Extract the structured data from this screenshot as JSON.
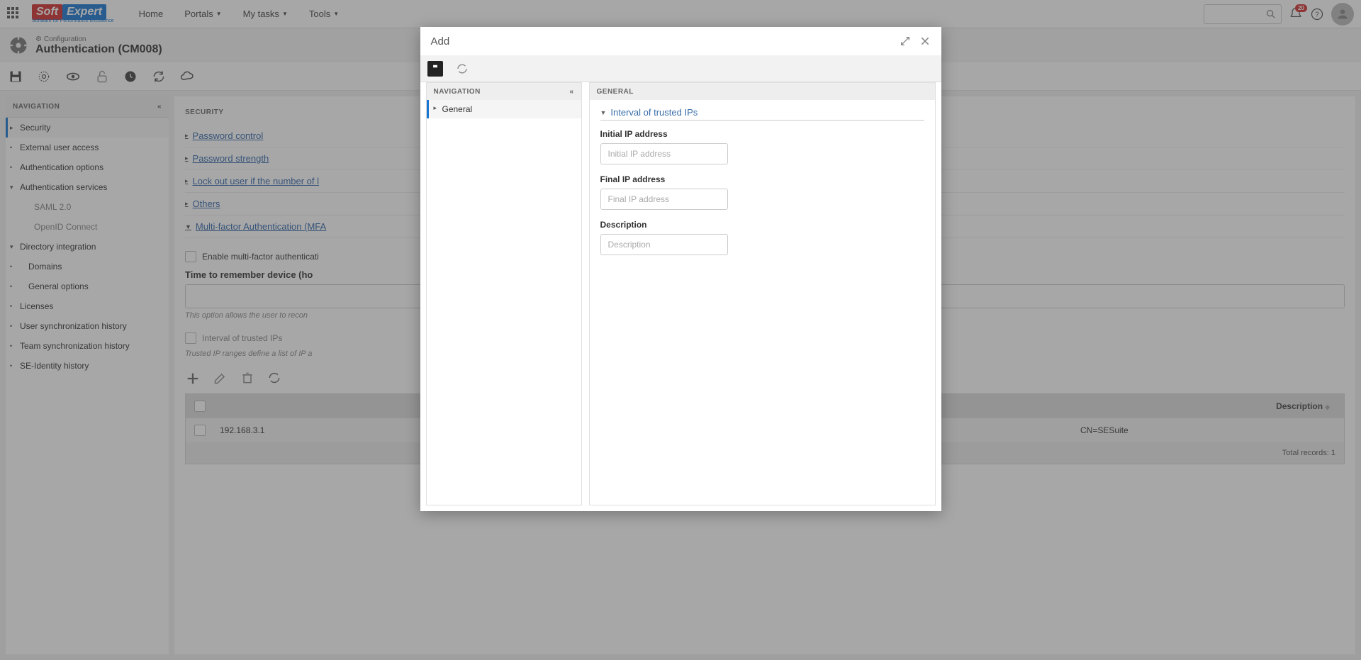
{
  "top": {
    "logo_soft": "Soft",
    "logo_expert": "Expert",
    "logo_sub": "Software for Performance Excellence",
    "home": "Home",
    "portals": "Portals",
    "mytasks": "My tasks",
    "tools": "Tools",
    "notif_count": "20"
  },
  "subheader": {
    "crumb": "Configuration",
    "title": "Authentication (CM008)"
  },
  "sidebar": {
    "title": "NAVIGATION",
    "items": [
      {
        "label": "Security",
        "type": "arrow-right",
        "active": true
      },
      {
        "label": "External user access",
        "type": "dot"
      },
      {
        "label": "Authentication options",
        "type": "dot"
      },
      {
        "label": "Authentication services",
        "type": "arrow-down"
      },
      {
        "label": "SAML 2.0",
        "type": "sub"
      },
      {
        "label": "OpenID Connect",
        "type": "sub"
      },
      {
        "label": "Directory integration",
        "type": "arrow-down"
      },
      {
        "label": "Domains",
        "type": "dot-sub"
      },
      {
        "label": "General options",
        "type": "dot-sub"
      },
      {
        "label": "Licenses",
        "type": "dot"
      },
      {
        "label": "User synchronization history",
        "type": "dot"
      },
      {
        "label": "Team synchronization history",
        "type": "dot"
      },
      {
        "label": "SE-Identity history",
        "type": "dot"
      }
    ]
  },
  "security": {
    "title": "SECURITY",
    "links": [
      "Password control",
      "Password strength",
      "Lock out user if the number of l",
      "Others"
    ],
    "mfa_title": "Multi-factor Authentication (MFA",
    "enable_mfa": "Enable multi-factor authenticati",
    "time_label": "Time to remember device (ho",
    "time_hint": "This option allows the user to recon",
    "interval_chk": "Interval of trusted IPs",
    "interval_hint": "Trusted IP ranges define a list of IP a",
    "table": {
      "col_desc": "Description",
      "row_ip": "192.168.3.1",
      "row_desc": "CN=SESuite",
      "footer_lbl": "Total records:",
      "footer_val": "1"
    }
  },
  "modal": {
    "title": "Add",
    "nav_title": "NAVIGATION",
    "nav_item": "General",
    "content_title": "GENERAL",
    "section": "Interval of trusted IPs",
    "f1_label": "Initial IP address",
    "f1_ph": "Initial IP address",
    "f2_label": "Final IP address",
    "f2_ph": "Final IP address",
    "f3_label": "Description",
    "f3_ph": "Description"
  }
}
